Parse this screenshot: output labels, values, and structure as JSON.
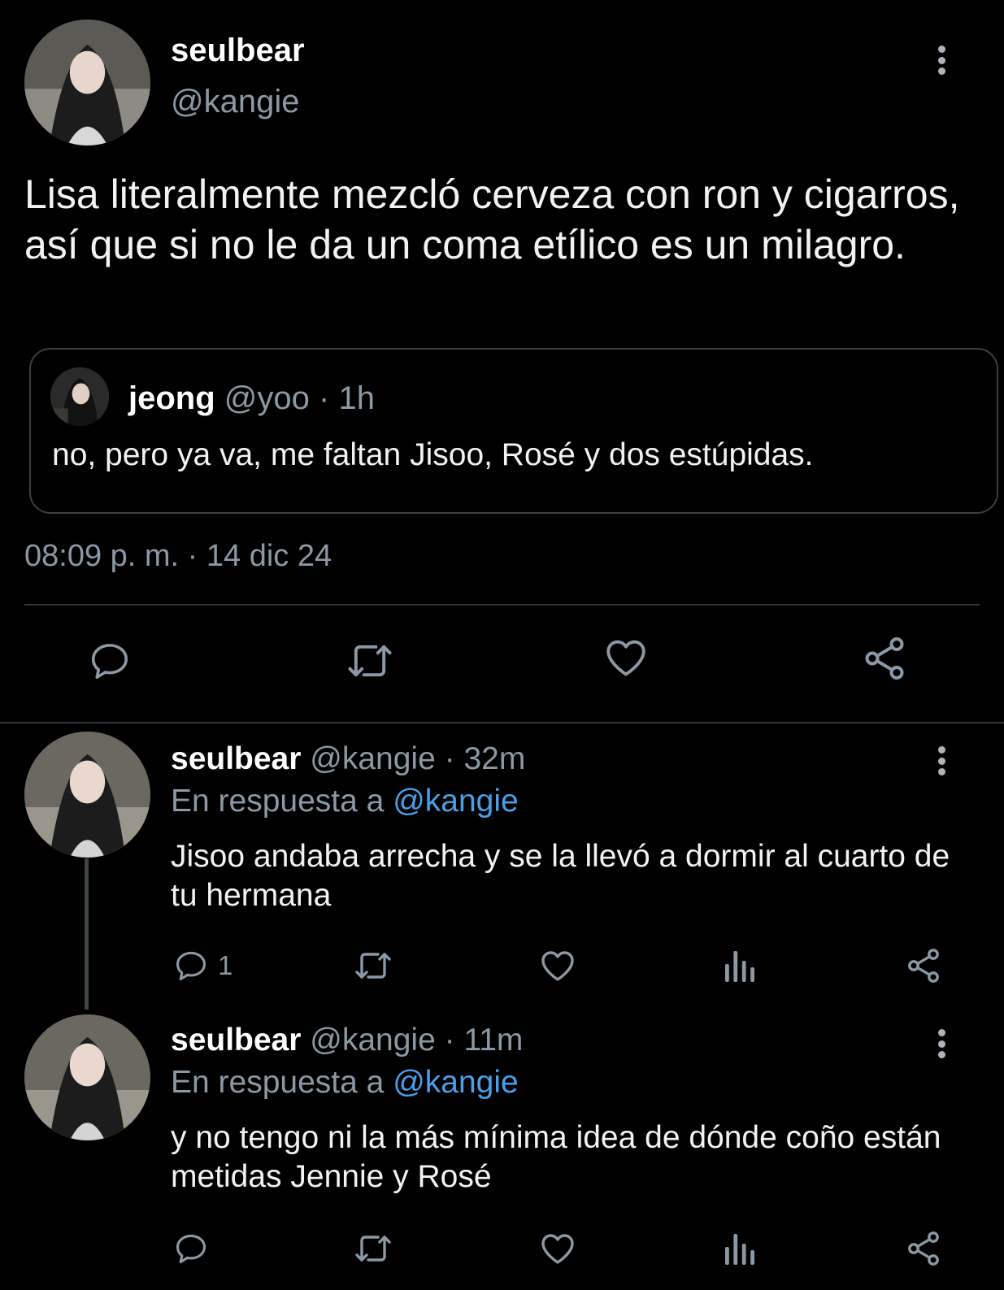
{
  "main_tweet": {
    "author_name": "seulbear",
    "author_handle": "@kangie",
    "text": "Lisa literalmente mezcló cerveza con ron y cigarros, así que si no le da un coma etílico es un milagro.",
    "quote": {
      "author_name": "jeong",
      "meta": "@yoo · 1h",
      "text": "no, pero ya va, me faltan Jisoo, Rosé y dos estúpidas."
    },
    "timestamp": "08:09 p. m. · 14 dic 24",
    "actions": [
      "reply-icon",
      "retweet-icon",
      "like-icon",
      "share-icon"
    ]
  },
  "replies": [
    {
      "author_name": "seulbear",
      "meta": "@kangie · 32m",
      "context_prefix": "En respuesta a",
      "context_handle": "@kangie",
      "text": "Jisoo andaba arrecha y se la llevó a dormir al cuarto de tu hermana",
      "reply_count": "1",
      "actions": [
        "reply-icon",
        "retweet-icon",
        "like-icon",
        "views-icon",
        "share-icon"
      ]
    },
    {
      "author_name": "seulbear",
      "meta": "@kangie · 11m",
      "context_prefix": "En respuesta a",
      "context_handle": "@kangie",
      "text": "y no tengo ni la más mínima idea de dónde coño están metidas Jennie y Rosé",
      "reply_count": "",
      "actions": [
        "reply-icon",
        "retweet-icon",
        "like-icon",
        "views-icon",
        "share-icon"
      ]
    }
  ],
  "colors": {
    "background": "#000000",
    "text": "#e7e9ea",
    "muted": "#8b98a5",
    "link": "#4a9fe8",
    "border": "#2f3336"
  }
}
